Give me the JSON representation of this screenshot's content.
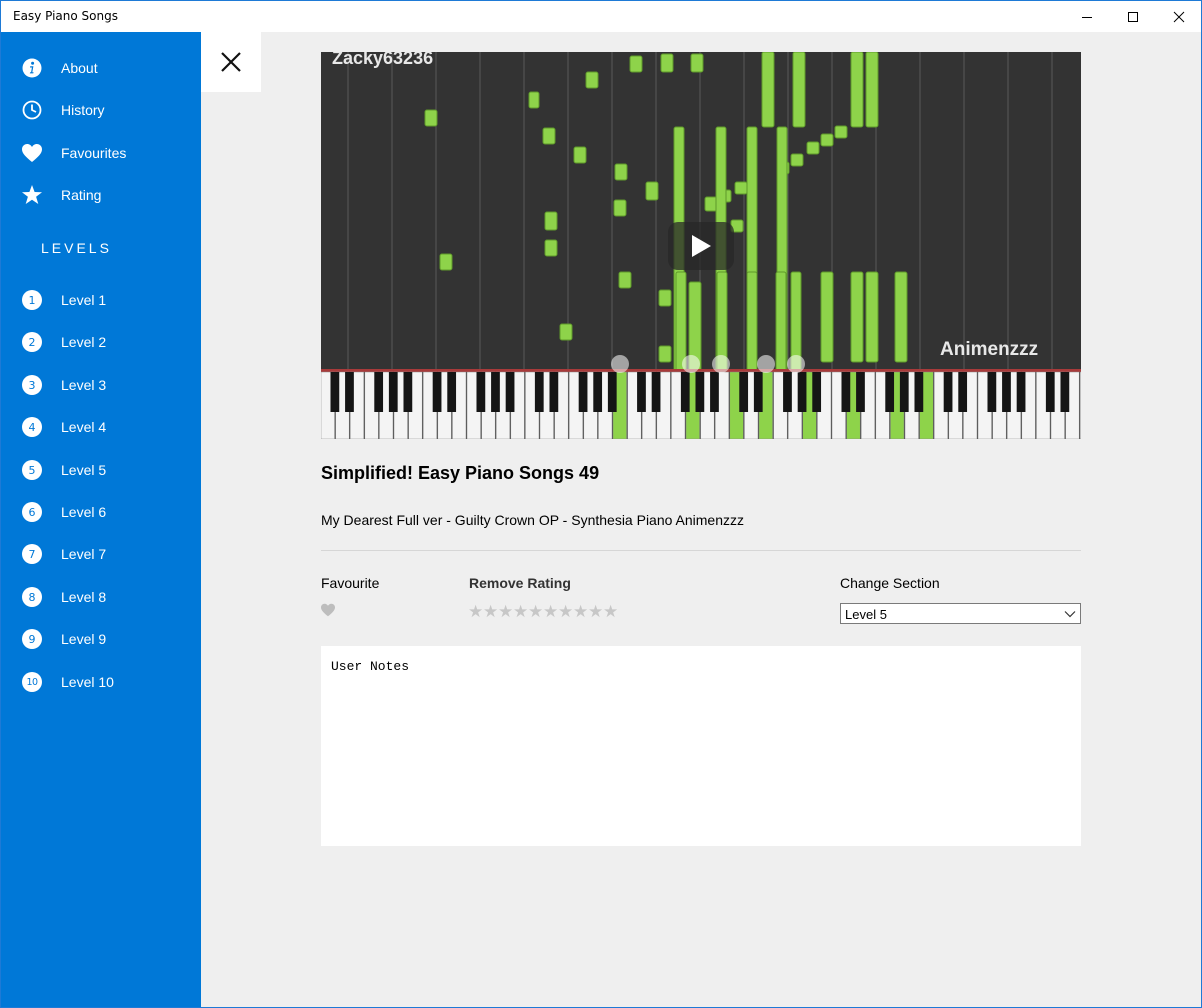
{
  "app": {
    "title": "Easy Piano Songs"
  },
  "window_controls": {
    "minimize": "minimize-icon",
    "maximize": "maximize-icon",
    "close": "close-icon"
  },
  "sidebar": {
    "menu": [
      {
        "label": "About",
        "icon": "info-icon"
      },
      {
        "label": "History",
        "icon": "clock-icon"
      },
      {
        "label": "Favourites",
        "icon": "heart-icon"
      },
      {
        "label": "Rating",
        "icon": "star-icon"
      }
    ],
    "levels_header": "LEVELS",
    "levels": [
      {
        "number": "1",
        "label": "Level 1"
      },
      {
        "number": "2",
        "label": "Level 2"
      },
      {
        "number": "3",
        "label": "Level 3"
      },
      {
        "number": "4",
        "label": "Level 4"
      },
      {
        "number": "5",
        "label": "Level 5"
      },
      {
        "number": "6",
        "label": "Level 6"
      },
      {
        "number": "7",
        "label": "Level 7"
      },
      {
        "number": "8",
        "label": "Level 8"
      },
      {
        "number": "9",
        "label": "Level 9"
      },
      {
        "number": "10",
        "label": "Level 10"
      }
    ]
  },
  "video": {
    "watermark_top": "Zacky63236",
    "watermark_right": "Animenzzz",
    "play_icon": "play-icon"
  },
  "song": {
    "title": "Simplified! Easy Piano Songs 49",
    "subtitle": "My Dearest Full ver - Guilty Crown OP - Synthesia Piano Animenzzz"
  },
  "controls": {
    "favourite_label": "Favourite",
    "rating_label": "Remove Rating",
    "rating_value": 0,
    "rating_max": 10,
    "section_label": "Change Section",
    "section_selected": "Level 5"
  },
  "notes": {
    "placeholder": "User Notes"
  },
  "colors": {
    "sidebar": "#0078d7",
    "note_green": "#8ed34a",
    "background": "#efefef"
  }
}
